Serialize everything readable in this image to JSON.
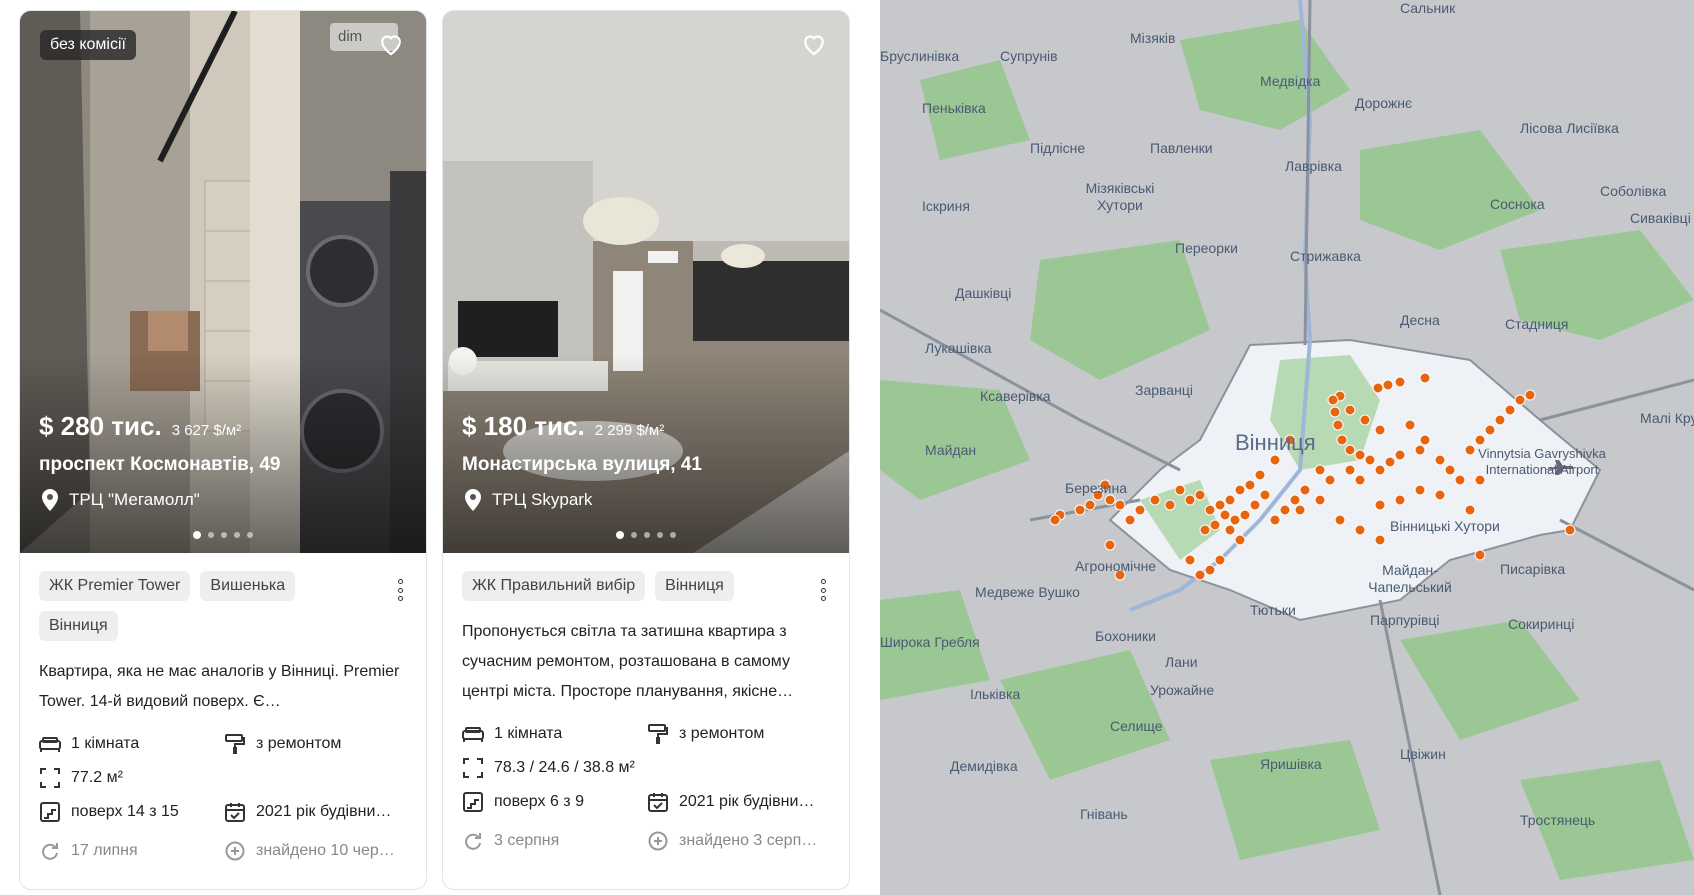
{
  "listings": [
    {
      "badge": "без комісії",
      "watermark": "dim",
      "price": "$ 280 тис.",
      "price_per_m2": "3 627 $/м²",
      "address": "проспект Космонавтів, 49",
      "landmark": "ТРЦ \"Мегамолл\"",
      "tags": [
        "ЖК Premier Tower",
        "Вишенька",
        "Вінниця"
      ],
      "description": "Квартира, яка не має аналогів у Вінниці. Premier Tower. 14-й видовий поверх. Є…",
      "rooms": "1 кімната",
      "renovation": "з ремонтом",
      "area": "77.2 м²",
      "floor": "поверх 14 з 15",
      "built": "2021 рік будівни…",
      "updated": "17 липня",
      "found": "знайдено 10 чер…"
    },
    {
      "badge": "",
      "watermark": "",
      "price": "$ 180 тис.",
      "price_per_m2": "2 299 $/м²",
      "address": "Монастирська вулиця, 41",
      "landmark": "ТРЦ Skypark",
      "tags": [
        "ЖК Правильний вибір",
        "Вінниця"
      ],
      "description": "Пропонується світла та затишна квартира з сучасним ремонтом, розташована в самому центрі міста. Просторе планування, якісне…",
      "rooms": "1 кімната",
      "renovation": "з ремонтом",
      "area": "78.3 / 24.6 / 38.8 м²",
      "floor": "поверх 6 з 9",
      "built": "2021 рік будівни…",
      "updated": "3 серпня",
      "found": "знайдено 3 серп…"
    }
  ],
  "map": {
    "city_label": "Вінниця",
    "airport_label": "Vinnytsia Gavryshivka International Airport",
    "places": [
      "Сальник",
      "Бруслинівка",
      "Супрунів",
      "Мізяків",
      "Медвідка",
      "Дорожнє",
      "Пеньківка",
      "Лісова Лисіївка",
      "Підлісне",
      "Павленки",
      "Лаврівка",
      "Соболівка",
      "Мізяківські Хутори",
      "Соснока",
      "Сиваківці",
      "Іскриня",
      "Переорки",
      "Стрижавка",
      "Дашківці",
      "Десна",
      "Стадниця",
      "Лукашівка",
      "Ксаверівка",
      "Зарванці",
      "Майдан",
      "Малі Крушлинці",
      "Березина",
      "Вінницькі Хутори",
      "Агрономічне",
      "Майдан-Чапельський",
      "Писарівка",
      "Медвеже Вушко",
      "Тютьки",
      "Широка Гребля",
      "Бохоники",
      "Парпурівці",
      "Сокиринці",
      "Лани",
      "Ільківка",
      "Урожайне",
      "Селище",
      "Цвіжин",
      "Демидівка",
      "Яришівка",
      "Гнівань",
      "Тростянець"
    ],
    "colors": {
      "marker": "#e8650f",
      "city": "#eef1f6",
      "forest": "#9bc795",
      "base": "#c6c8cc",
      "road": "#8c929c"
    }
  }
}
